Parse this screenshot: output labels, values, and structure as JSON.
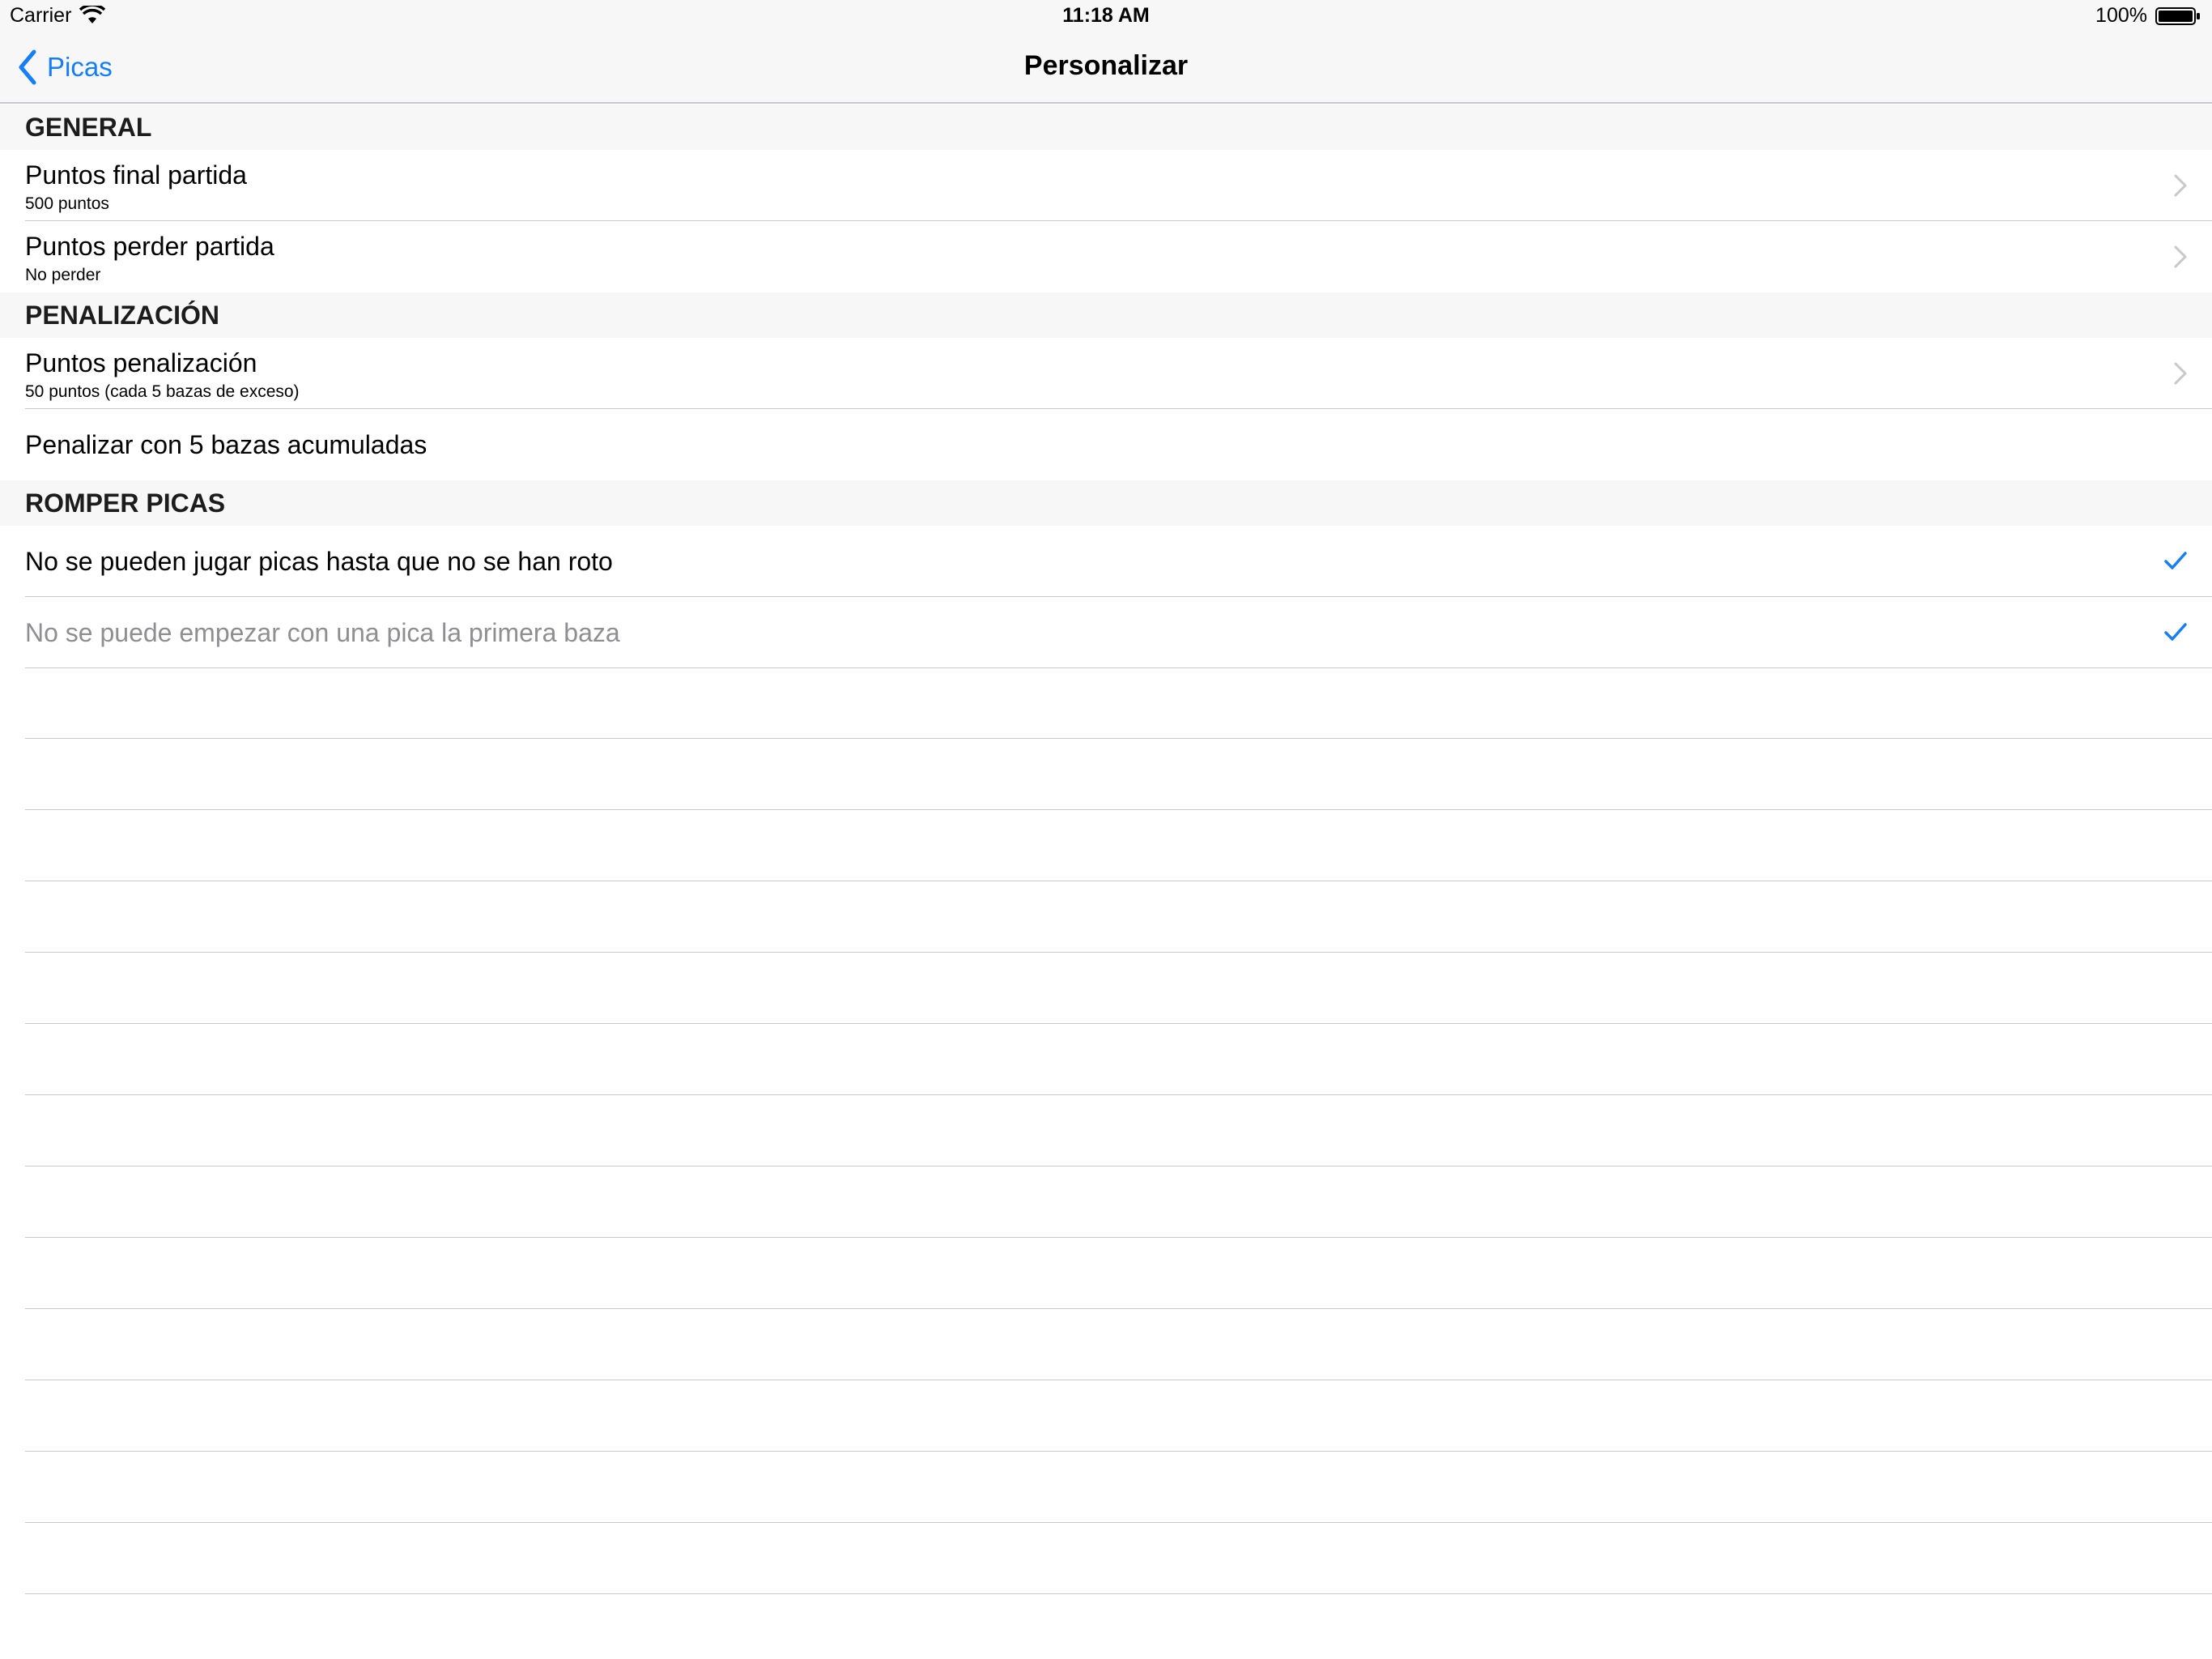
{
  "status_bar": {
    "carrier": "Carrier",
    "time": "11:18 AM",
    "battery": "100%"
  },
  "nav": {
    "back_label": "Picas",
    "title": "Personalizar",
    "accent_color": "#157efb"
  },
  "sections": [
    {
      "header": "GENERAL",
      "rows": [
        {
          "title": "Puntos final partida",
          "subtitle": "500 puntos",
          "accessory": "chevron"
        },
        {
          "title": "Puntos perder partida",
          "subtitle": "No perder",
          "accessory": "chevron"
        }
      ]
    },
    {
      "header": "PENALIZACIÓN",
      "rows": [
        {
          "title": "Puntos penalización",
          "subtitle": "50 puntos (cada 5 bazas de exceso)",
          "accessory": "chevron"
        },
        {
          "title": "Penalizar con 5 bazas acumuladas",
          "accessory": "none"
        }
      ]
    },
    {
      "header": "ROMPER PICAS",
      "rows": [
        {
          "title": "No se pueden jugar picas hasta que no se han roto",
          "accessory": "checkmark",
          "checked": true
        },
        {
          "title": "No se puede empezar con una pica la primera baza",
          "accessory": "checkmark",
          "checked": true,
          "disabled": true
        }
      ]
    }
  ]
}
